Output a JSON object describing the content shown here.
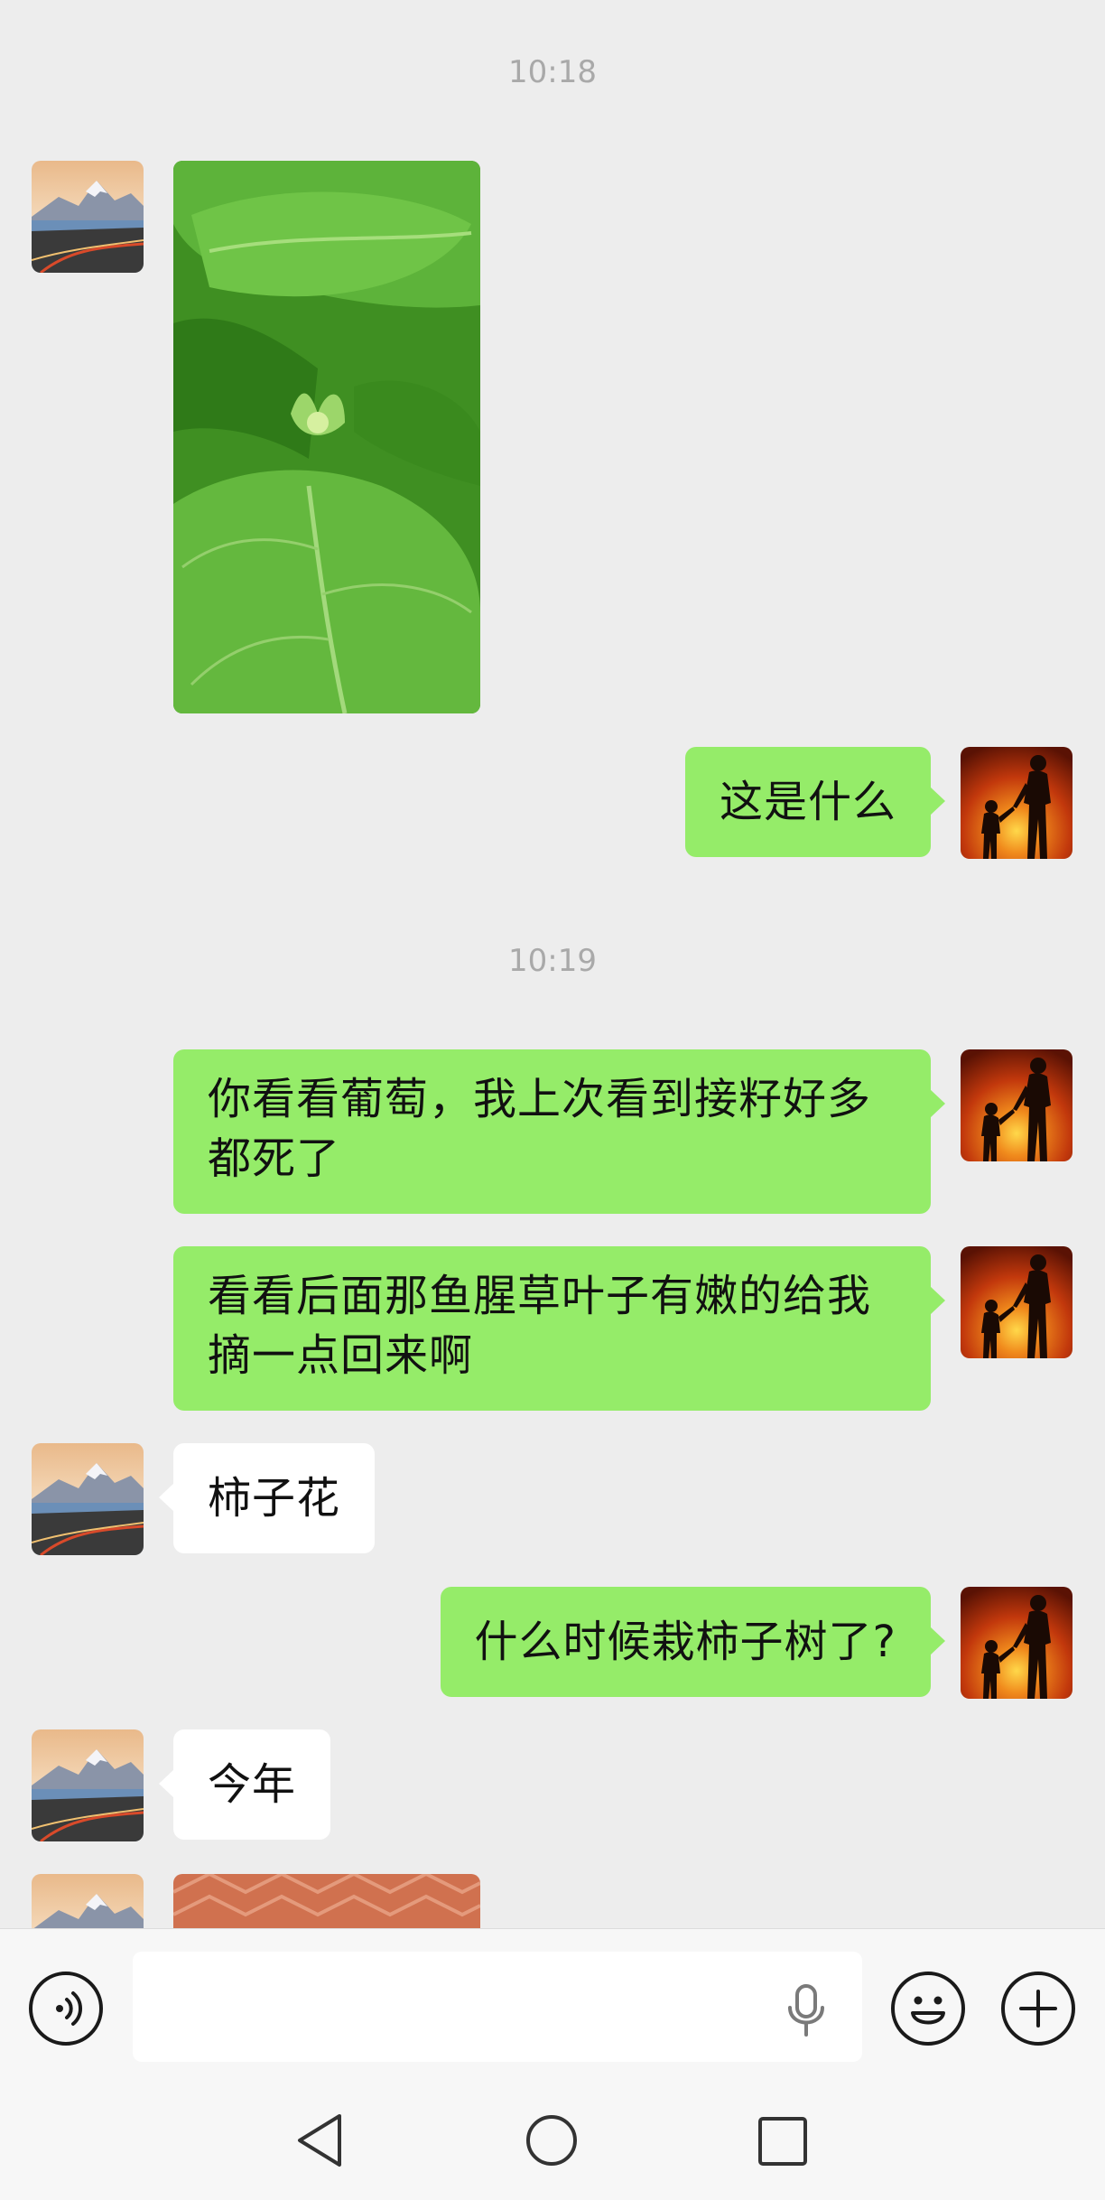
{
  "timestamps": [
    "10:18",
    "10:19"
  ],
  "messages": {
    "m2": "这是什么",
    "m3": "你看看葡萄，我上次看到接籽好多都死了",
    "m4": "看看后面那鱼腥草叶子有嫩的给我摘一点回来啊",
    "m5": "柿子花",
    "m6": "什么时候栽柿子树了?",
    "m7": "今年"
  },
  "input": {
    "placeholder": ""
  },
  "icons": {
    "voice": "voice-input-icon",
    "mic": "microphone-icon",
    "emoji": "emoji-icon",
    "plus": "plus-icon",
    "back": "nav-back-icon",
    "home": "nav-home-icon",
    "recents": "nav-recents-icon"
  },
  "colors": {
    "chat_bg": "#ededed",
    "outgoing_bubble": "#95ec69",
    "incoming_bubble": "#ffffff",
    "timestamp": "#a9a9a9",
    "bar_bg": "#f7f7f7"
  }
}
